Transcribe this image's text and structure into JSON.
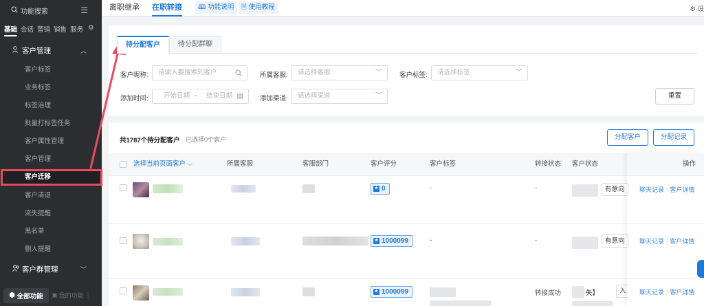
{
  "sidebar": {
    "search_label": "功能搜索",
    "tabs": [
      "基础",
      "会话",
      "营销",
      "销售",
      "服务"
    ],
    "groups": {
      "customer_mgmt": "客户管理",
      "customer_group_mgmt": "客户群管理"
    },
    "items": [
      "客户标签",
      "业务标签",
      "标签治理",
      "批量打标签任务",
      "客户属性管理",
      "客户管理",
      "客户迁移",
      "客户清退",
      "流失提醒",
      "黑名单",
      "删人提醒"
    ],
    "all_functions": "全部功能",
    "my_functions": "我的功能"
  },
  "topbar": {
    "tabs": [
      "离职继承",
      "在职转接"
    ],
    "chips": [
      "功能说明",
      "使用教程"
    ],
    "settings": "设"
  },
  "filter": {
    "subtabs": [
      "待分配客户",
      "待分配群聊"
    ],
    "nickname_label": "客户昵称:",
    "nickname_placeholder": "请输入要搜索的客户",
    "agent_label": "所属客服:",
    "agent_placeholder": "请选择客服",
    "tag_label": "客户标签:",
    "tag_placeholder": "请选择标签",
    "time_label": "添加时间:",
    "start_date": "开始日期",
    "end_date": "结束日期",
    "channel_label": "添加渠道:",
    "channel_placeholder": "请选择渠道",
    "reset": "重置"
  },
  "table": {
    "summary": "共1787个待分配客户",
    "selected": "已选择0个客户",
    "assign_btn": "分配客户",
    "records_btn": "分配记录",
    "headers": [
      "选择当前页面客户",
      "所属客服",
      "客服部门",
      "客户评分",
      "客户标签",
      "转接状态",
      "客户状态",
      "操作"
    ],
    "rows": [
      {
        "score": "0",
        "tag": "-",
        "transfer": "-",
        "status": "有意向",
        "op1": "聊天记录",
        "op2": "客户详情"
      },
      {
        "score": "1000099",
        "tag": "-",
        "transfer": "-",
        "status": "有意向",
        "op1": "聊天记录",
        "op2": "客户详情"
      },
      {
        "score": "1000099",
        "tag": "",
        "transfer": "转接成功",
        "status": "失】",
        "status_btn": "入",
        "op1": "聊天记录",
        "op2": "客户详情"
      }
    ]
  },
  "colors": {
    "accent": "#1f7ad6",
    "sidebar_bg": "#2b2d31",
    "highlight_red": "#e84a5f"
  }
}
